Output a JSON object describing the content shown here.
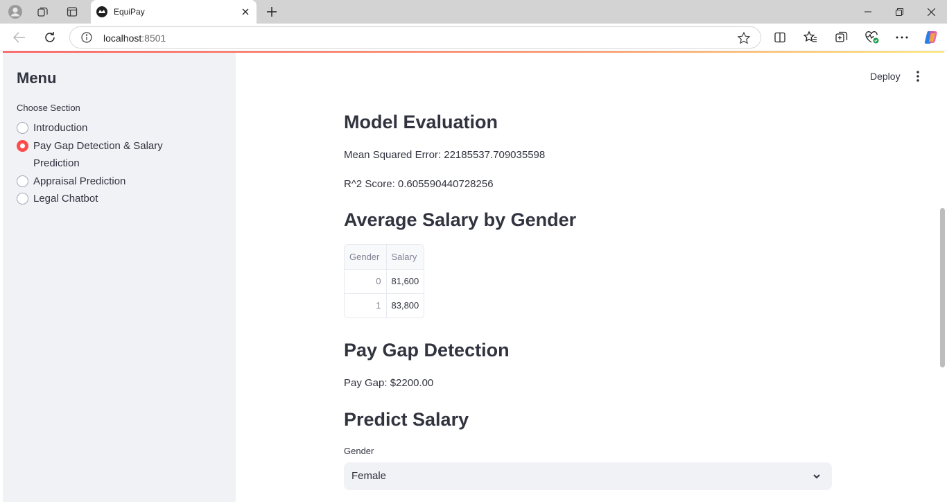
{
  "browser": {
    "tab_title": "EquiPay",
    "url_host": "localhost",
    "url_port": ":8501"
  },
  "app": {
    "deploy_label": "Deploy"
  },
  "sidebar": {
    "title": "Menu",
    "radio_label": "Choose Section",
    "options": [
      {
        "label": "Introduction",
        "selected": false
      },
      {
        "label": "Pay Gap Detection & Salary Prediction",
        "selected": true
      },
      {
        "label": "Appraisal Prediction",
        "selected": false
      },
      {
        "label": "Legal Chatbot",
        "selected": false
      }
    ]
  },
  "main": {
    "model_eval_heading": "Model Evaluation",
    "mse_text": "Mean Squared Error: 22185537.709035598",
    "r2_text": "R^2 Score: 0.605590440728256",
    "avg_salary_heading": "Average Salary by Gender",
    "table": {
      "columns": [
        "Gender",
        "Salary"
      ],
      "rows": [
        {
          "index": "0",
          "salary": "81,600"
        },
        {
          "index": "1",
          "salary": "83,800"
        }
      ]
    },
    "pay_gap_heading": "Pay Gap Detection",
    "pay_gap_text": "Pay Gap: $2200.00",
    "predict_heading": "Predict Salary",
    "gender_label": "Gender",
    "gender_value": "Female"
  },
  "colors": {
    "accent": "#ff4b4b",
    "sidebar_bg": "#f0f2f6",
    "text": "#31333f"
  }
}
